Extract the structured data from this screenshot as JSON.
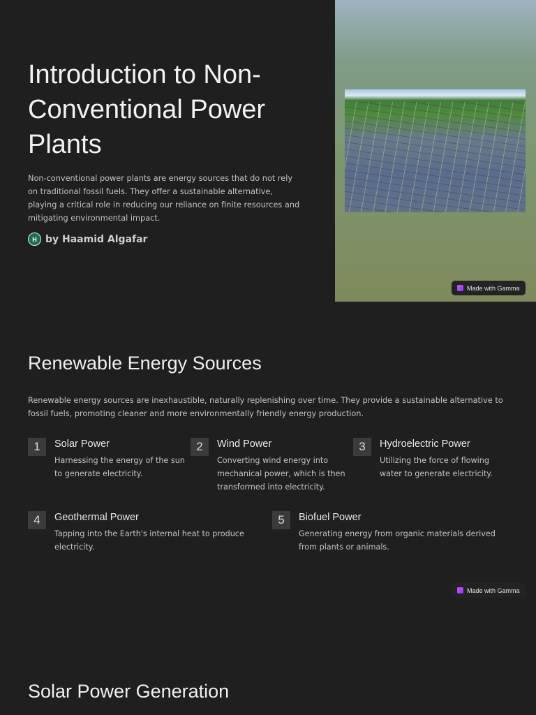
{
  "hero": {
    "title": "Introduction to Non-Conventional Power Plants",
    "description": "Non-conventional power plants are energy sources that do not rely on traditional fossil fuels. They offer a sustainable alternative, playing a critical role in reducing our reliance on finite resources and mitigating environmental impact.",
    "author_initial": "H",
    "author": "by Haamid Algafar"
  },
  "badge": "Made with Gamma",
  "renewable": {
    "title": "Renewable Energy Sources",
    "description": "Renewable energy sources are inexhaustible, naturally replenishing over time. They provide a sustainable alternative to fossil fuels, promoting cleaner and more environmentally friendly energy production.",
    "items": [
      {
        "num": "1",
        "title": "Solar Power",
        "desc": "Harnessing the energy of the sun to generate electricity."
      },
      {
        "num": "2",
        "title": "Wind Power",
        "desc": "Converting wind energy into mechanical power, which is then transformed into electricity."
      },
      {
        "num": "3",
        "title": "Hydroelectric Power",
        "desc": "Utilizing the force of flowing water to generate electricity."
      },
      {
        "num": "4",
        "title": "Geothermal Power",
        "desc": "Tapping into the Earth's internal heat to produce electricity."
      },
      {
        "num": "5",
        "title": "Biofuel Power",
        "desc": "Generating energy from organic materials derived from plants or animals."
      }
    ]
  },
  "solar": {
    "title": "Solar Power Generation"
  }
}
